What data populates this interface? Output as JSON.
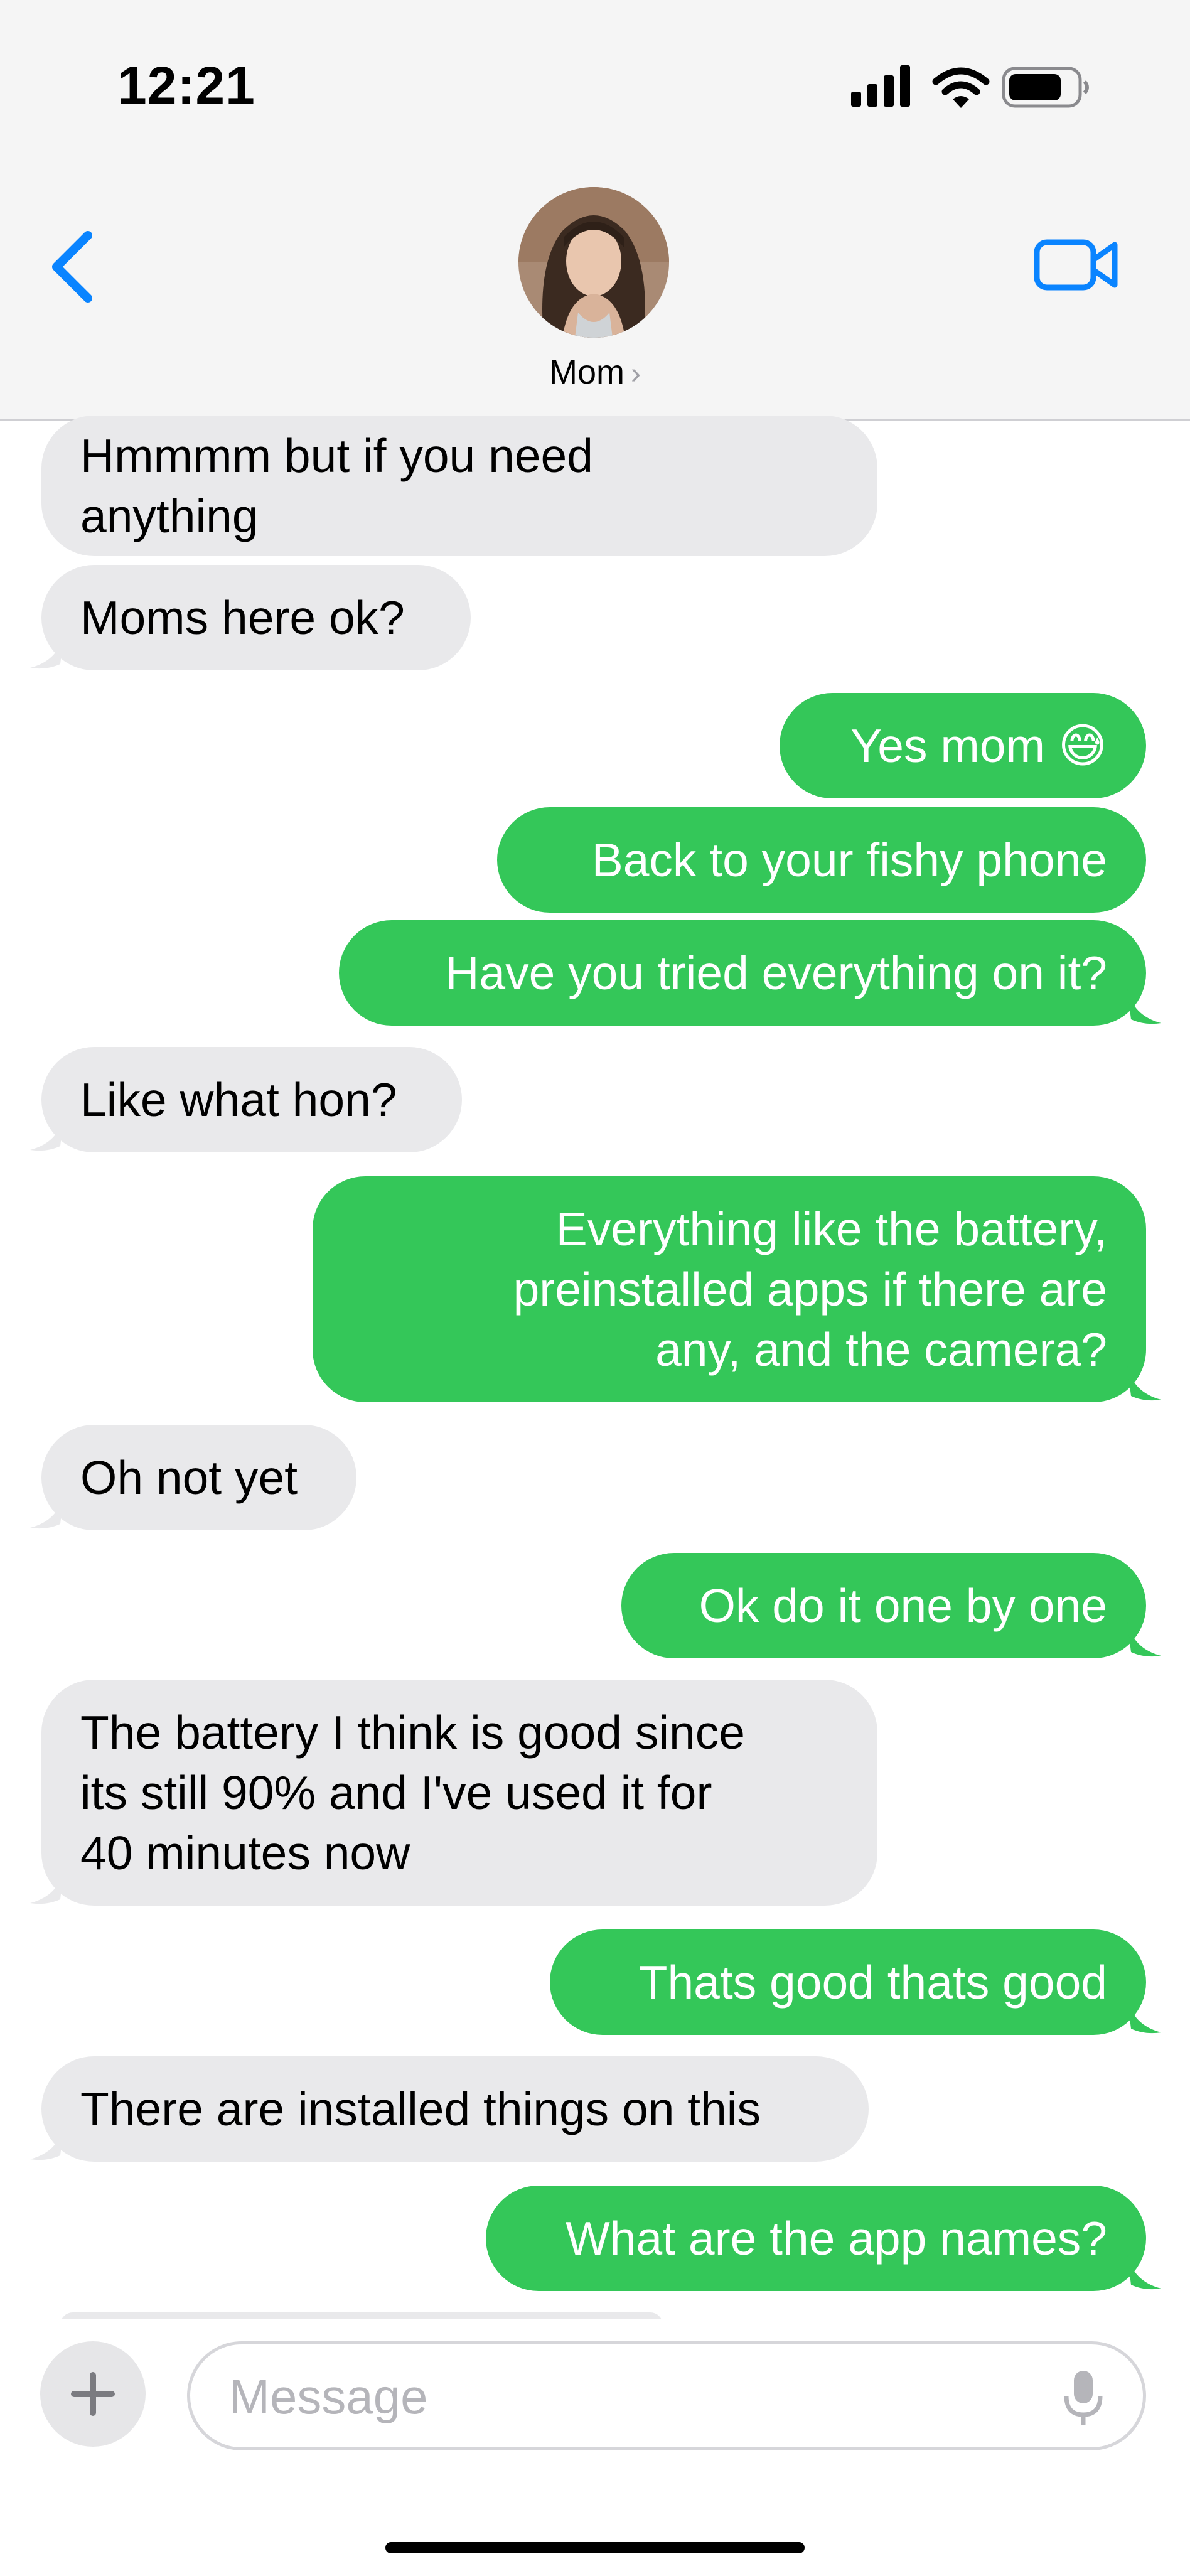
{
  "status_bar": {
    "time": "12:21"
  },
  "header": {
    "contact_name": "Mom",
    "chevron": "›"
  },
  "messages": [
    {
      "side": "in",
      "lines": [
        "Hmmmm but if you need",
        "anything"
      ]
    },
    {
      "side": "in",
      "lines": [
        "Moms here ok?"
      ]
    },
    {
      "side": "out",
      "lines": [
        "Yes mom 😅"
      ]
    },
    {
      "side": "out",
      "lines": [
        "Back to your fishy phone"
      ]
    },
    {
      "side": "out",
      "lines": [
        "Have you tried everything on it?"
      ]
    },
    {
      "side": "in",
      "lines": [
        "Like what hon?"
      ]
    },
    {
      "side": "out",
      "lines": [
        "Everything like the battery,",
        "preinstalled apps if there are",
        "any, and the camera?"
      ]
    },
    {
      "side": "in",
      "lines": [
        "Oh not yet"
      ]
    },
    {
      "side": "out",
      "lines": [
        "Ok do it one by one"
      ]
    },
    {
      "side": "in",
      "lines": [
        "The battery I think is good since",
        "its still 90% and I've used it for",
        "40 minutes now"
      ]
    },
    {
      "side": "out",
      "lines": [
        "Thats good thats good"
      ]
    },
    {
      "side": "in",
      "lines": [
        "There are installed things on this"
      ]
    },
    {
      "side": "out",
      "lines": [
        "What are the app names?"
      ]
    }
  ],
  "composer": {
    "placeholder": "Message",
    "plus_label": "+"
  },
  "icons": {
    "back": "chevron-left-icon",
    "video": "video-camera-icon",
    "mic": "microphone-icon",
    "signal": "cellular-signal-icon",
    "wifi": "wifi-icon",
    "battery": "battery-icon"
  },
  "colors": {
    "outgoing": "#34c759",
    "incoming": "#e9e9eb",
    "accent": "#0a84ff"
  }
}
